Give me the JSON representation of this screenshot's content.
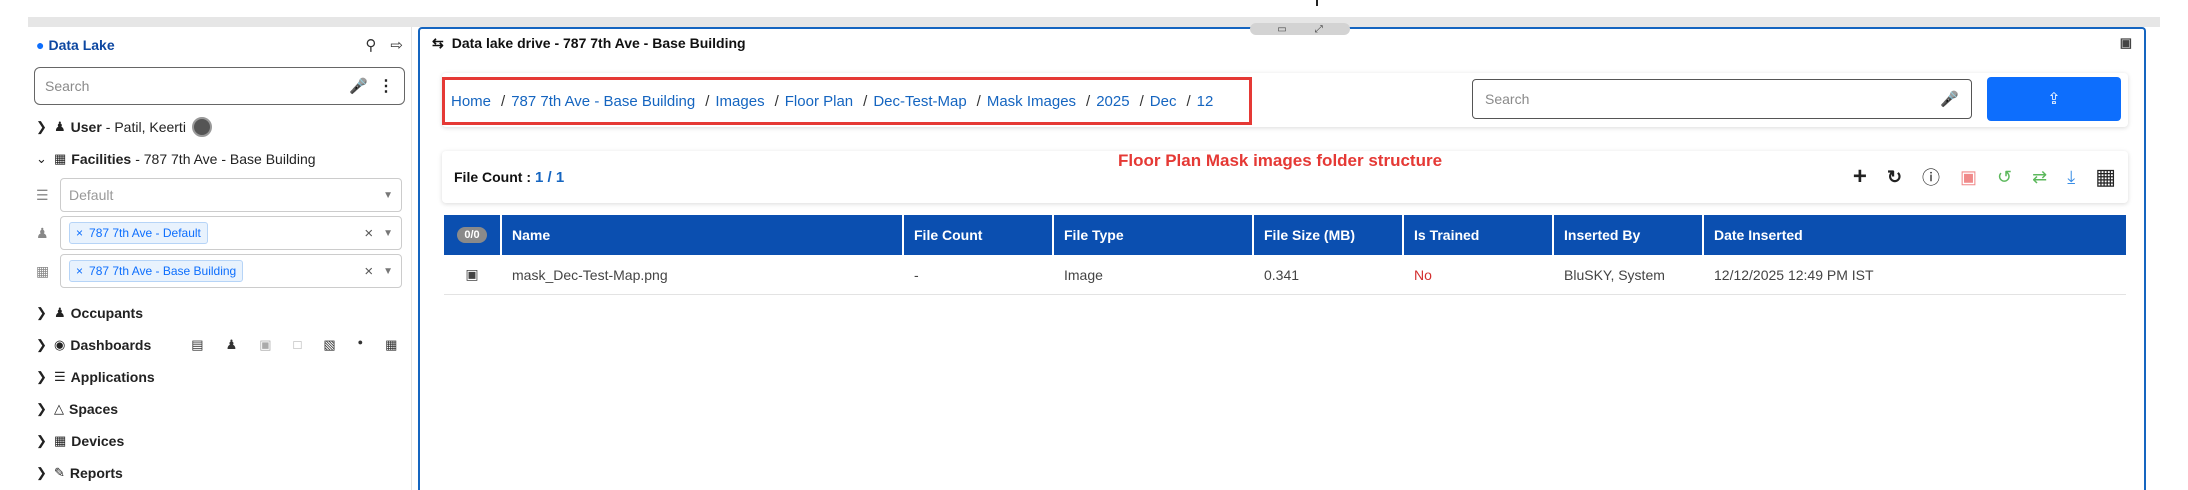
{
  "sidebar": {
    "title": "Data Lake",
    "search_placeholder": "Search",
    "user": {
      "label": "User",
      "value": "- Patil, Keerti"
    },
    "facilities": {
      "label": "Facilities",
      "value": "- 787 7th Ave - Base Building"
    },
    "select_default": "Default",
    "chip1": "787 7th Ave - Default",
    "chip2": "787 7th Ave - Base Building",
    "items": [
      {
        "label": "Occupants"
      },
      {
        "label": "Dashboards"
      },
      {
        "label": "Applications"
      },
      {
        "label": "Spaces"
      },
      {
        "label": "Devices"
      },
      {
        "label": "Reports"
      }
    ]
  },
  "panel": {
    "title": "Data lake drive - 787 7th Ave - Base Building",
    "breadcrumb": [
      "Home",
      "787 7th Ave - Base Building",
      "Images",
      "Floor Plan",
      "Dec-Test-Map",
      "Mask Images",
      "2025",
      "Dec",
      "12"
    ],
    "search_placeholder": "Search",
    "annotation": "Floor Plan Mask images folder structure",
    "file_count_label": "File Count :",
    "file_count_value": "1 / 1"
  },
  "table": {
    "select_badge": "0/0",
    "headers": [
      "Name",
      "File Count",
      "File Type",
      "File Size (MB)",
      "Is Trained",
      "Inserted By",
      "Date Inserted"
    ],
    "rows": [
      [
        "mask_Dec-Test-Map.png",
        "-",
        "Image",
        "0.341",
        "No",
        "BluSKY, System",
        "12/12/2025 12:49 PM IST"
      ]
    ]
  },
  "colors": {
    "accent": "#0d6efd",
    "header": "#0b4fb0",
    "annotation": "#e53935",
    "no": "#d32f2f"
  }
}
